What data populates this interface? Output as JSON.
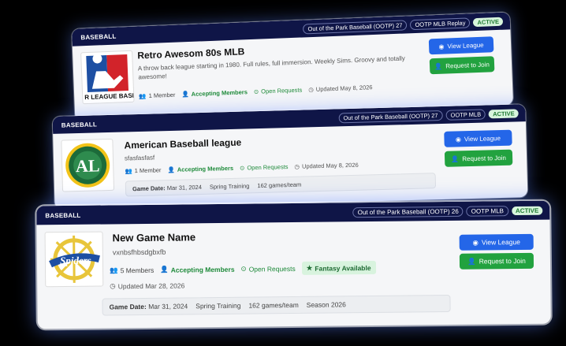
{
  "cards": [
    {
      "sport": "BASEBALL",
      "game_tag": "Out of the Park Baseball (OOTP) 27",
      "mode_tag": "OOTP MLB Replay",
      "status": "ACTIVE",
      "title": "Retro Awesom 80s MLB",
      "description": "A throw back league starting in 1980. Full rules, full immersion. Weekly Sims. Groovy and totally awesome!",
      "members": "1 Member",
      "accepting": "Accepting Members",
      "requests": "Open Requests",
      "updated": "Updated May 8, 2026",
      "logo_text": "R LEAGUE BASE",
      "view_label": "View League",
      "join_label": "Request to Join"
    },
    {
      "sport": "BASEBALL",
      "game_tag": "Out of the Park Baseball (OOTP) 27",
      "mode_tag": "OOTP MLB",
      "status": "ACTIVE",
      "title": "American Baseball league",
      "description": "sfasfasfasf",
      "members": "1 Member",
      "accepting": "Accepting Members",
      "requests": "Open Requests",
      "updated": "Updated May 8, 2026",
      "game_date_label": "Game Date:",
      "game_date": "Mar 31, 2024",
      "phase": "Spring Training",
      "games": "162 games/team",
      "view_label": "View League",
      "join_label": "Request to Join"
    },
    {
      "sport": "BASEBALL",
      "game_tag": "Out of the Park Baseball (OOTP) 26",
      "mode_tag": "OOTP MLB",
      "status": "ACTIVE",
      "title": "New Game Name",
      "description": "vxnbsfhbsdgbxfb",
      "members": "5 Members",
      "accepting": "Accepting Members",
      "requests": "Open Requests",
      "fantasy": "Fantasy Available",
      "updated": "Updated Mar 28, 2026",
      "game_date_label": "Game Date:",
      "game_date": "Mar 31, 2024",
      "phase": "Spring Training",
      "games": "162 games/team",
      "season": "Season 2026",
      "view_label": "View League",
      "join_label": "Request to Join"
    }
  ],
  "colors": {
    "header": "#0f1547",
    "blue_button": "#2466e8",
    "green_button": "#22a23f",
    "accent_green": "#1e8a3a"
  }
}
